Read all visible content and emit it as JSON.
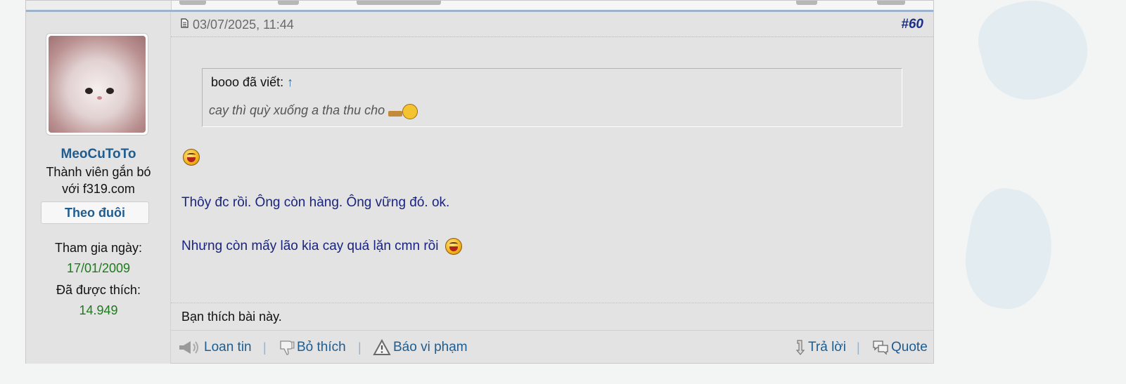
{
  "post": {
    "date": "03/07/2025, 11:44",
    "number": "#60"
  },
  "user": {
    "name": "MeoCuToTo",
    "title_line1": "Thành viên gắn bó",
    "title_line2": "với f319.com",
    "follow_label": "Theo đuôi",
    "joined_label": "Tham gia ngày:",
    "joined_value": "17/01/2009",
    "likes_label": "Đã được thích:",
    "likes_value": "14.949"
  },
  "quote": {
    "author": "booo đã viết:",
    "arrow": "↑",
    "text": "cay thì quỳ xuống a tha thu cho"
  },
  "body": {
    "line1": "Thôy đc rồi. Ông còn hàng. Ông vững đó. ok.",
    "line2": "Nhưng còn mấy lão kia cay quá lặn cmn rồi"
  },
  "like_text": "Bạn thích bài này.",
  "actions": {
    "share": "Loan tin",
    "unlike": "Bỏ thích",
    "report": "Báo vi phạm",
    "reply": "Trả lời",
    "quote": "Quote",
    "separator": "|"
  },
  "colors": {
    "link": "#1f5c8f",
    "post_number": "#1a2f8c",
    "body_text": "#1a237e",
    "stat_value": "#1d7a1d"
  }
}
